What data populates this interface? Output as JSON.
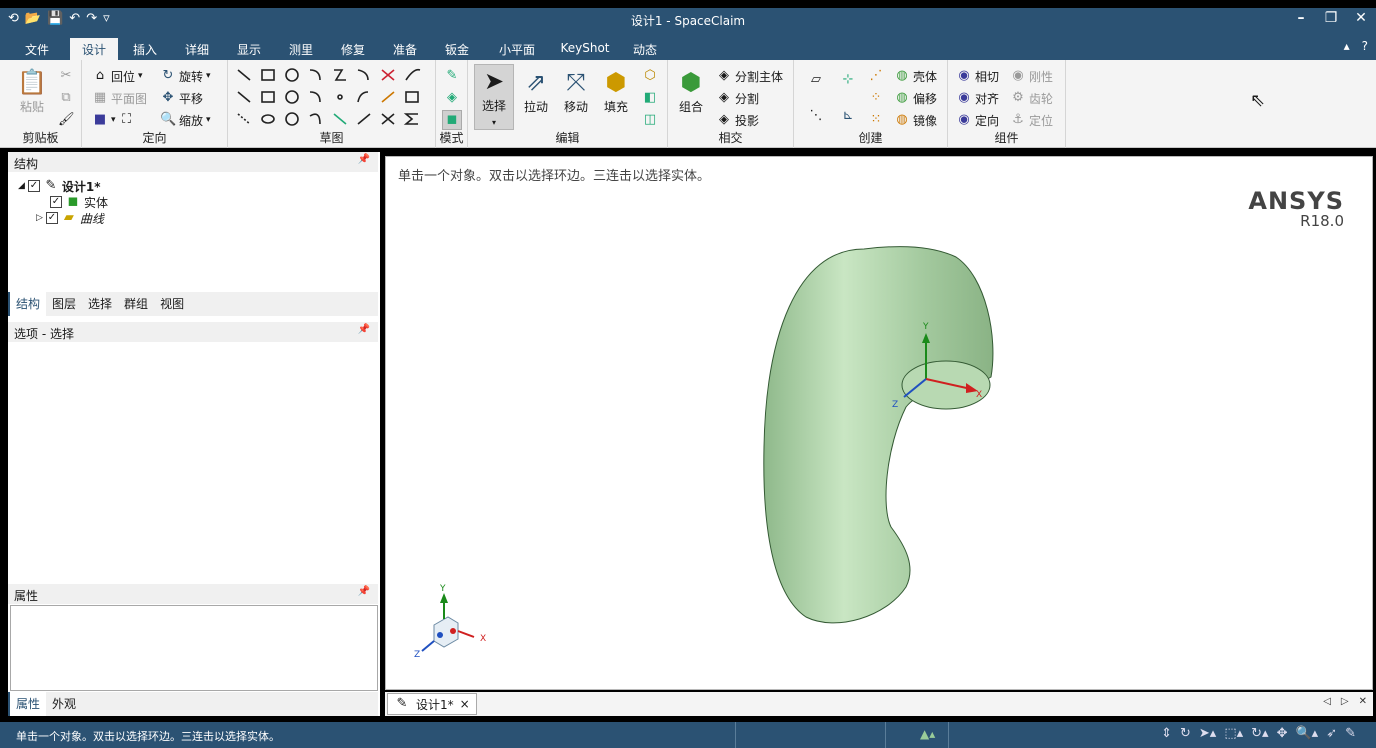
{
  "window": {
    "title": "设计1 - SpaceClaim"
  },
  "tabs": [
    "文件",
    "设计",
    "插入",
    "详细",
    "显示",
    "测里",
    "修复",
    "准备",
    "钣金",
    "小平面",
    "KeyShot",
    "动态"
  ],
  "active_tab": "设计",
  "ribbon": {
    "clipboard": {
      "label": "剪贴板",
      "paste": "粘贴"
    },
    "orient": {
      "label": "定向",
      "home": "回位",
      "plan_view": "平面图",
      "spin": "旋转",
      "pan": "平移",
      "zoom": "缩放"
    },
    "sketch": {
      "label": "草图"
    },
    "mode": {
      "label": "模式"
    },
    "edit": {
      "label": "编辑",
      "select": "选择",
      "pull": "拉动",
      "move": "移动",
      "fill": "填充"
    },
    "intersect": {
      "label": "相交",
      "combine": "组合",
      "split_body": "分割主体",
      "split": "分割",
      "project": "投影"
    },
    "create": {
      "label": "创建",
      "shell": "壳体",
      "offset": "偏移",
      "mirror": "镜像"
    },
    "assembly": {
      "label": "组件",
      "tangent": "相切",
      "align": "对齐",
      "orient": "定向",
      "rigid": "刚性",
      "gear": "齿轮",
      "anchor": "定位"
    }
  },
  "structure_panel": {
    "title": "结构",
    "root": "设计1*",
    "children": [
      "实体",
      "曲线"
    ],
    "tabs": [
      "结构",
      "图层",
      "选择",
      "群组",
      "视图"
    ]
  },
  "options_panel": {
    "title": "选项 - 选择"
  },
  "properties_panel": {
    "title": "属性",
    "tabs": [
      "属性",
      "外观"
    ]
  },
  "viewport": {
    "hint": "单击一个对象。双击以选择环边。三连击以选择实体。",
    "brand": "ANSYS",
    "version": "R18.0",
    "axis_x": "X",
    "axis_y": "Y",
    "axis_z": "Z"
  },
  "document_tab": {
    "label": "设计1*",
    "close": "×"
  },
  "status": {
    "text": "单击一个对象。双击以选择环边。三连击以选择实体。"
  },
  "colors": {
    "chrome": "#2b5273",
    "ribbon": "#f4f4f4",
    "body": "#9fc49b"
  }
}
